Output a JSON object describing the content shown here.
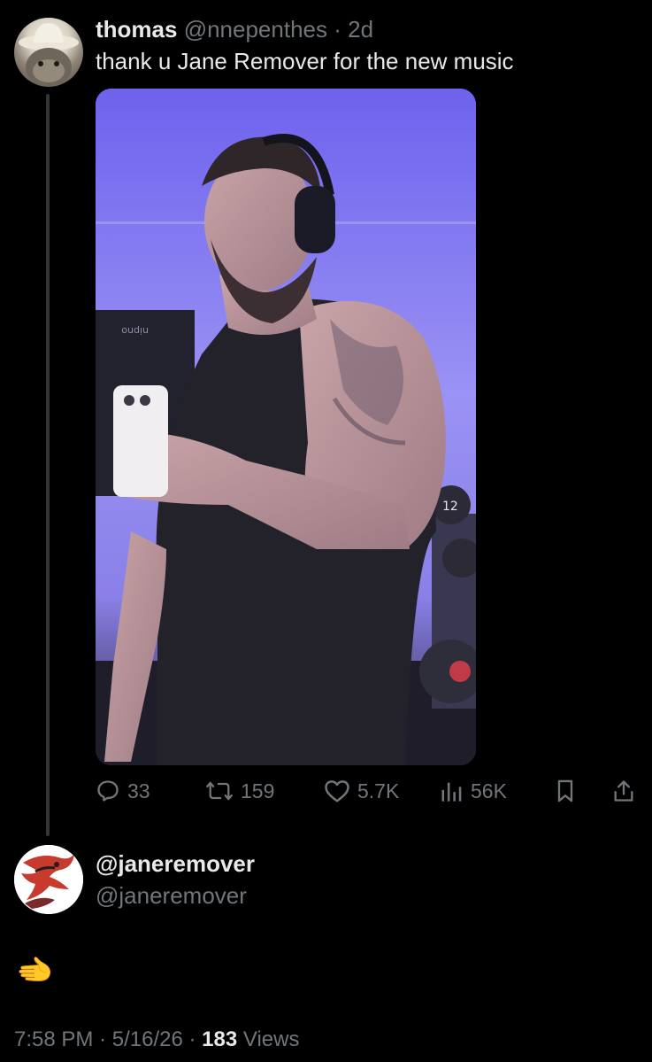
{
  "tweet": {
    "author_name": "thomas",
    "author_handle": "@nnepenthes",
    "separator": "·",
    "age": "2d",
    "text": "thank u Jane Remover for the new music",
    "media": {
      "kettlebell_label": "12",
      "bag_label": "nipno"
    },
    "stats": {
      "replies": "33",
      "reposts": "159",
      "likes": "5.7K",
      "views": "56K"
    }
  },
  "reply": {
    "author_name": "@janeremover",
    "author_handle": "@janeremover",
    "emoji": "🫲"
  },
  "footer": {
    "time": "7:58 PM",
    "separator1": "·",
    "date": "5/16/26",
    "separator2": "·",
    "views_count": "183",
    "views_label": "Views"
  },
  "icons": {
    "reply": "comment-icon",
    "repost": "repost-icon",
    "like": "heart-icon",
    "views": "analytics-icon",
    "bookmark": "bookmark-icon",
    "share": "share-icon"
  },
  "colors": {
    "background": "#000000",
    "primary_text": "#e7e9ea",
    "secondary_text": "#71767b",
    "thread_line": "#333639"
  }
}
